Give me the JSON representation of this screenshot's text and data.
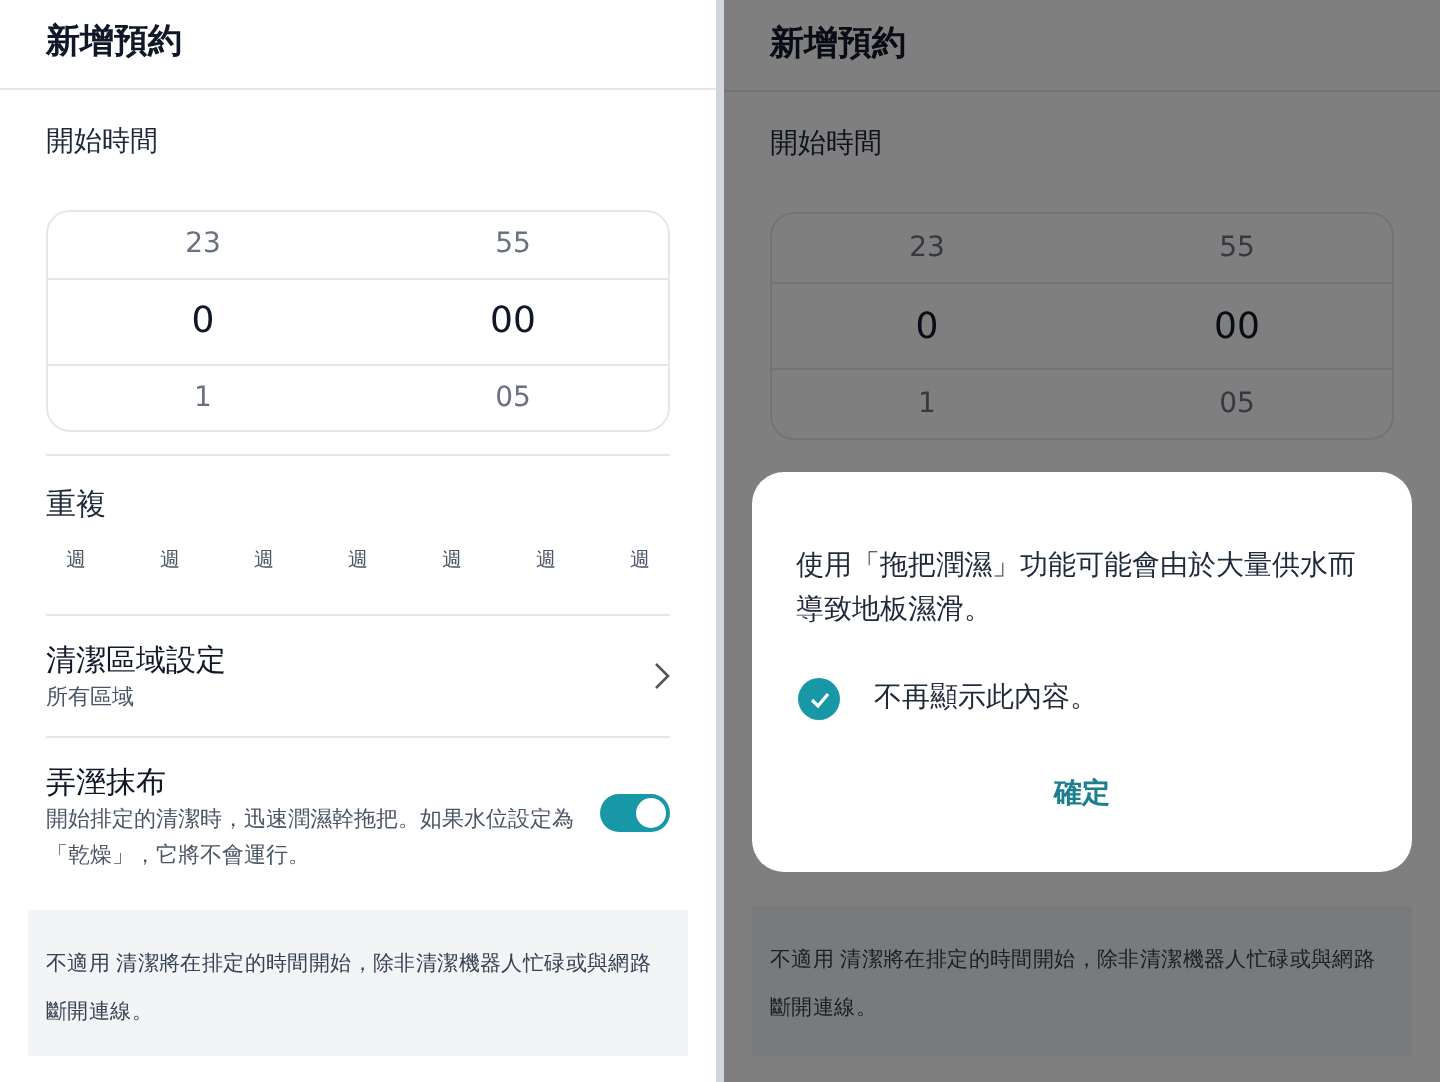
{
  "screens": [
    {
      "title": "新增預約",
      "start_time": {
        "label": "開始時間",
        "columns": [
          {
            "above": "23",
            "current": "0",
            "below": "1"
          },
          {
            "above": "55",
            "current": "00",
            "below": "05"
          }
        ]
      },
      "repeat": {
        "label": "重複",
        "days": [
          "週",
          "週",
          "週",
          "週",
          "週",
          "週",
          "週"
        ]
      },
      "area": {
        "title": "清潔區域設定",
        "value": "所有區域"
      },
      "mop": {
        "title": "弄溼抹布",
        "description": "開始排定的清潔時，迅速潤濕幹拖把。如果水位設定為「乾燥」，它將不會運行。",
        "on": true
      },
      "note": "不適用 清潔將在排定的時間開始，除非清潔機器人忙碌或與網路斷開連線。"
    },
    {
      "title": "新增預約",
      "start_time": {
        "label": "開始時間",
        "columns": [
          {
            "above": "23",
            "current": "0",
            "below": "1"
          },
          {
            "above": "55",
            "current": "00",
            "below": "05"
          }
        ]
      },
      "note": "不適用 清潔將在排定的時間開始，除非清潔機器人忙碌或與網路斷開連線。",
      "dialog": {
        "message": "使用「拖把潤濕」功能可能會由於大量供水而導致地板濕滑。",
        "checkbox": {
          "label": "不再顯示此內容。",
          "checked": true
        },
        "button": "確定"
      }
    }
  ]
}
